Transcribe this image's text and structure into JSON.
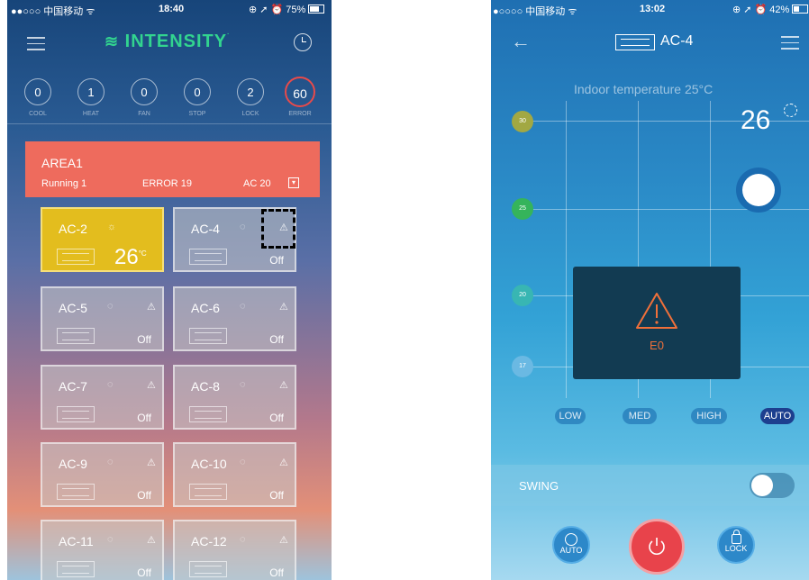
{
  "left": {
    "status": {
      "carrier": "●●○○○ 中国移动 ᯤ",
      "time": "18:40",
      "battery": "⊕ ➚ ⏰ 75%"
    },
    "logo": "INTENSITY",
    "stats": [
      {
        "value": "0",
        "label": "COOL"
      },
      {
        "value": "1",
        "label": "HEAT"
      },
      {
        "value": "0",
        "label": "FAN"
      },
      {
        "value": "0",
        "label": "STOP"
      },
      {
        "value": "2",
        "label": "LOCK"
      },
      {
        "value": "60",
        "label": "ERROR"
      }
    ],
    "area": {
      "title": "AREA1",
      "running": "Running 1",
      "error": "ERROR 19",
      "count": "AC 20"
    },
    "tiles": [
      {
        "name": "AC-2",
        "status": "26",
        "unit": "°C"
      },
      {
        "name": "AC-4",
        "status": "Off"
      },
      {
        "name": "AC-5",
        "status": "Off"
      },
      {
        "name": "AC-6",
        "status": "Off"
      },
      {
        "name": "AC-7",
        "status": "Off"
      },
      {
        "name": "AC-8",
        "status": "Off"
      },
      {
        "name": "AC-9",
        "status": "Off"
      },
      {
        "name": "AC-10",
        "status": "Off"
      },
      {
        "name": "AC-11",
        "status": "Off"
      },
      {
        "name": "AC-12",
        "status": "Off"
      }
    ]
  },
  "right": {
    "status": {
      "carrier": "●○○○○ 中国移动 ᯤ",
      "time": "13:02",
      "battery": "⊕ ➚ ⏰ 42%"
    },
    "title": "AC-4",
    "indoor": "Indoor temperature 25°C",
    "setpoint": "26",
    "scale": [
      "30",
      "25",
      "20",
      "17"
    ],
    "error_code": "E0",
    "fan": [
      "LOW",
      "MED",
      "HIGH",
      "AUTO"
    ],
    "fan_selected": "AUTO",
    "swing_label": "SWING",
    "auto_label": "AUTO",
    "lock_label": "LOCK",
    "colors": {
      "power": "#e8434b",
      "warning": "#f0703a",
      "tile_on": "#e3bd1e",
      "area": "#ee6b5d"
    }
  }
}
